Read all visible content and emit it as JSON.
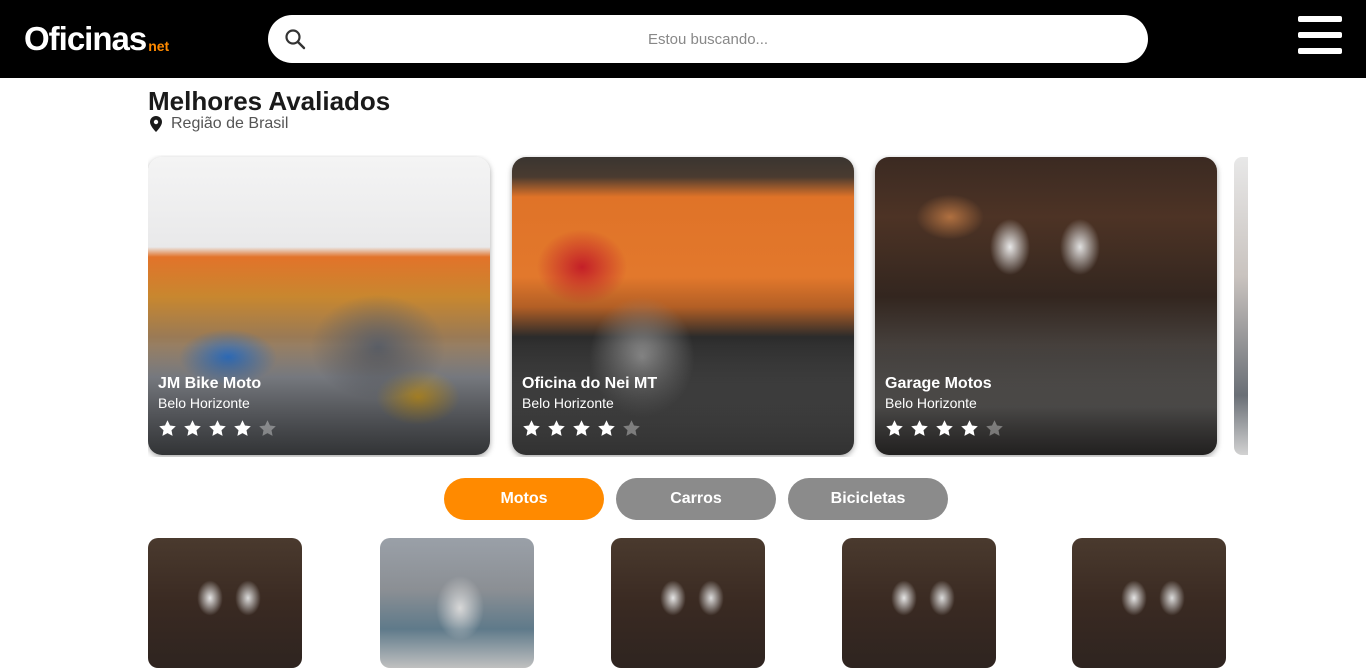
{
  "header": {
    "logo_text": "Oficinas",
    "logo_suffix": "net",
    "search_placeholder": "Estou buscando..."
  },
  "section": {
    "title": "Melhores Avaliados",
    "location": "Região de Brasil"
  },
  "colors": {
    "brand_orange": "#ff8a00",
    "header_black": "#000000",
    "tab_inactive": "#8b8b8b"
  },
  "cards": [
    {
      "name": "JM Bike Moto",
      "city": "Belo Horizonte",
      "rating": 4
    },
    {
      "name": "Oficina do Nei MT",
      "city": "Belo Horizonte",
      "rating": 4
    },
    {
      "name": "Garage Motos",
      "city": "Belo Horizonte",
      "rating": 4
    }
  ],
  "tabs": [
    {
      "label": "Motos",
      "active": true
    },
    {
      "label": "Carros",
      "active": false
    },
    {
      "label": "Bicicletas",
      "active": false
    }
  ],
  "icons": {
    "search": "search-icon",
    "menu": "hamburger-menu-icon",
    "location": "map-pin-icon",
    "star": "star-icon"
  }
}
